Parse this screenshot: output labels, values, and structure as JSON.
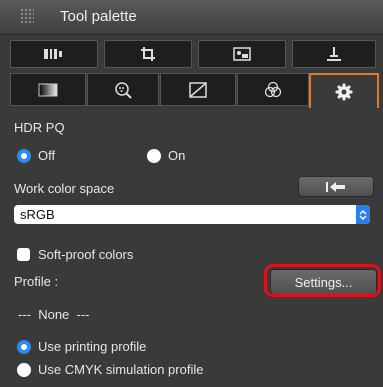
{
  "window": {
    "title": "Tool palette"
  },
  "toolbar": {
    "buttons": [
      "tool-1-icon",
      "crop-icon",
      "image-icon",
      "stamp-icon"
    ]
  },
  "tabs": {
    "icons": [
      "basic-adjust-icon",
      "detail-icon",
      "curve-icon",
      "color-icon",
      "gear-icon"
    ],
    "active_index": 4
  },
  "hdr": {
    "heading": "HDR PQ",
    "off_label": "Off",
    "on_label": "On",
    "selected": "Off"
  },
  "color_space": {
    "heading": "Work color space",
    "value": "sRGB"
  },
  "softproof": {
    "checkbox_label": "Soft-proof colors",
    "checked": false,
    "profile_label": "Profile :",
    "settings_button": "Settings...",
    "profile_value": "---  None  ---",
    "option_printing": "Use printing profile",
    "option_cmyk": "Use CMYK simulation profile",
    "selected": "Use printing profile"
  },
  "colors": {
    "accent": "#2a8bf2",
    "active_tab": "#e07a1f",
    "highlight": "#e0101a"
  }
}
